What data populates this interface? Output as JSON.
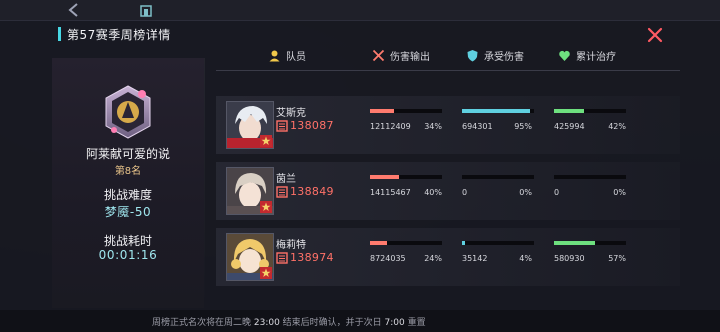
{
  "window": {
    "title": "第57赛季周榜详情"
  },
  "player": {
    "name": "阿莱献可爱的说",
    "rank": "第8名",
    "difficulty_label": "挑战难度",
    "difficulty_value": "梦魇-50",
    "time_label": "挑战耗时",
    "time_value": "00:01:16"
  },
  "table": {
    "headers": {
      "member": "队员",
      "damage": "伤害输出",
      "taken": "承受伤害",
      "heal": "累计治疗"
    },
    "rows": [
      {
        "name": "艾斯克",
        "power": "138087",
        "damage": "12112409",
        "damage_pct": "34%",
        "damage_frac": 0.34,
        "taken": "694301",
        "taken_pct": "95%",
        "taken_frac": 0.95,
        "heal": "425994",
        "heal_pct": "42%",
        "heal_frac": 0.42
      },
      {
        "name": "茵兰",
        "power": "138849",
        "damage": "14115467",
        "damage_pct": "40%",
        "damage_frac": 0.4,
        "taken": "0",
        "taken_pct": "0%",
        "taken_frac": 0,
        "heal": "0",
        "heal_pct": "0%",
        "heal_frac": 0
      },
      {
        "name": "梅莉特",
        "power": "138974",
        "damage": "8724035",
        "damage_pct": "24%",
        "damage_frac": 0.24,
        "taken": "35142",
        "taken_pct": "4%",
        "taken_frac": 0.04,
        "heal": "580930",
        "heal_pct": "57%",
        "heal_frac": 0.57
      }
    ]
  },
  "footer": {
    "prefix": "周榜正式名次将在周二晚 ",
    "time1": "23:00",
    "middle": " 结束后时确认，并于次日 ",
    "time2": "7:00",
    "suffix": " 重置"
  },
  "colors": {
    "damage": "#ff7b6e",
    "taken": "#5fd0e0",
    "heal": "#6ee07f",
    "accent": "#47d7e4",
    "close": "#ff5a63"
  },
  "icons": {
    "back": "back-arrow-icon",
    "home": "home-icon",
    "close": "close-icon",
    "member": "member-icon",
    "damage": "crossed-swords-icon",
    "taken": "shield-icon",
    "heal": "heart-icon",
    "power": "power-icon"
  }
}
